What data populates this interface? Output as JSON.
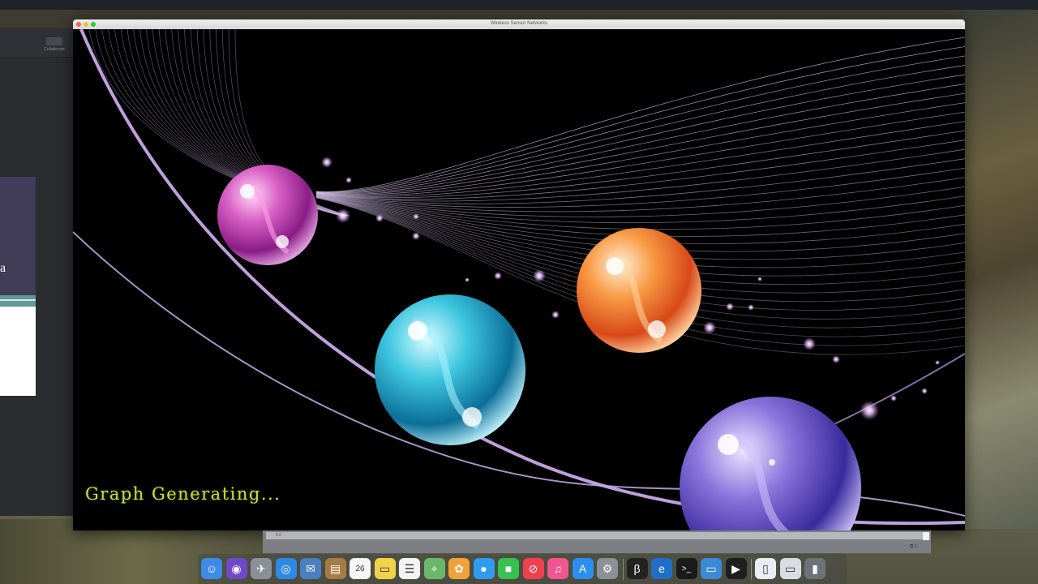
{
  "window": {
    "title": "Wireless Sensor Networks"
  },
  "status_text": "Graph Generating...",
  "background_app": {
    "collaborate_label": "Collaborate",
    "slide_letter": "a"
  },
  "timeline": {
    "position_label": "0.0"
  },
  "colors": {
    "status_text": "#c8e034",
    "sphere_magenta": "#c23aa8",
    "sphere_cyan": "#1fa6c4",
    "sphere_orange": "#f07a28",
    "sphere_purple": "#6650c0"
  },
  "dock": {
    "items": [
      {
        "name": "finder-icon",
        "color": "#3d8ce8",
        "glyph": "☺"
      },
      {
        "name": "siri-icon",
        "color": "#7048c8",
        "glyph": "◉"
      },
      {
        "name": "launchpad-icon",
        "color": "#8a8f99",
        "glyph": "✈"
      },
      {
        "name": "safari-icon",
        "color": "#2e88e6",
        "glyph": "◎"
      },
      {
        "name": "mail-photos-icon",
        "color": "#4a7fc0",
        "glyph": "✉"
      },
      {
        "name": "notes-folder-icon",
        "color": "#a87a44",
        "glyph": "▤"
      },
      {
        "name": "calendar-icon",
        "color": "#f6f6f6",
        "glyph": "26"
      },
      {
        "name": "stickies-icon",
        "color": "#f1d34a",
        "glyph": "▭"
      },
      {
        "name": "reminders-icon",
        "color": "#f4f4f4",
        "glyph": "☰"
      },
      {
        "name": "maps-icon",
        "color": "#6ab86a",
        "glyph": "⌖"
      },
      {
        "name": "photos-icon",
        "color": "#f2a23a",
        "glyph": "✿"
      },
      {
        "name": "messages-icon",
        "color": "#2f9cf0",
        "glyph": "●"
      },
      {
        "name": "facetime-icon",
        "color": "#35c24e",
        "glyph": "■"
      },
      {
        "name": "news-icon",
        "color": "#f04050",
        "glyph": "⊘"
      },
      {
        "name": "itunes-icon",
        "color": "#f25590",
        "glyph": "♫"
      },
      {
        "name": "app-store-icon",
        "color": "#2b8ff0",
        "glyph": "A"
      },
      {
        "name": "system-preferences-icon",
        "color": "#8d9096",
        "glyph": "⚙"
      },
      {
        "name": "pycharm-icon",
        "color": "#222222",
        "glyph": "β"
      },
      {
        "name": "edge-icon",
        "color": "#1e6fc8",
        "glyph": "e"
      },
      {
        "name": "terminal-icon",
        "color": "#1a1a1a",
        "glyph": ">_"
      },
      {
        "name": "keynote-icon",
        "color": "#3a8ad6",
        "glyph": "▭"
      },
      {
        "name": "quicktime-icon",
        "color": "#1f1f1f",
        "glyph": "▶"
      },
      {
        "name": "document-icon",
        "color": "#e8eef4",
        "glyph": "▯"
      },
      {
        "name": "window-thumbnail-icon",
        "color": "#d9dde2",
        "glyph": "▭"
      },
      {
        "name": "trash-icon",
        "color": "#6d7278",
        "glyph": "▮"
      }
    ]
  }
}
